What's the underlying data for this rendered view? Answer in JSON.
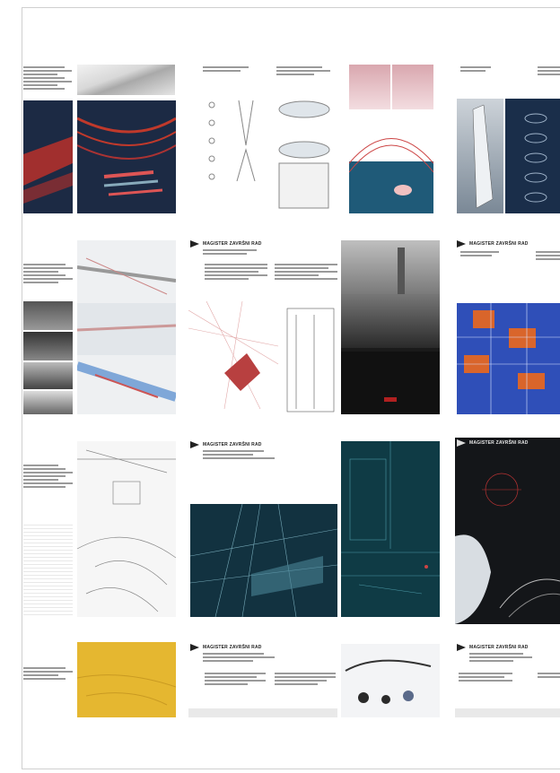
{
  "page": {
    "title_text": "MAGISTER ZAVRŠNI RAD",
    "rows": 4
  },
  "colors": {
    "navy": "#1c2a44",
    "red": "#b8302a",
    "teal": "#1f5a78",
    "orange": "#d9652b",
    "blue": "#2f4fb8",
    "yellow": "#e5b730",
    "dark": "#15171a"
  }
}
